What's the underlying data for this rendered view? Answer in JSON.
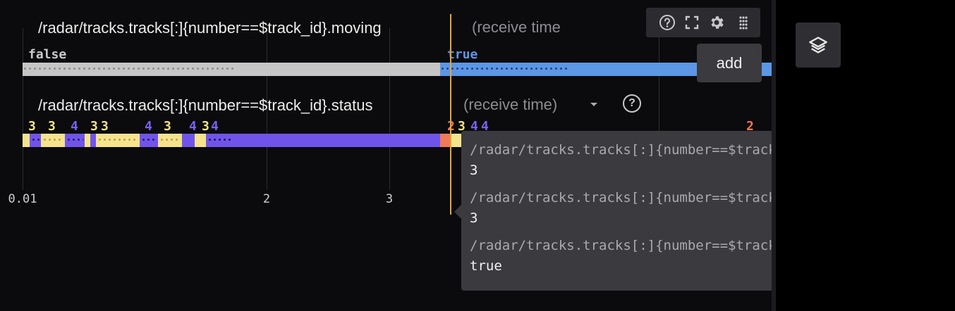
{
  "plot": {
    "row1": {
      "topic": "/radar/tracks.tracks[:]{number==$track_id}.moving",
      "time_selector": "(receive time)",
      "labels": [
        "false",
        "true"
      ],
      "segment_values": [
        "false",
        "true"
      ]
    },
    "row2": {
      "topic": "/radar/tracks.tracks[:]{number==$track_id}.status",
      "time_selector": "(receive time)",
      "labels": [
        "3",
        "3",
        "4",
        "3",
        "3",
        "4",
        "3",
        "4",
        "3",
        "4",
        "2",
        "3",
        "4",
        "4",
        "2"
      ]
    },
    "x_axis": {
      "ticks": [
        "0.01",
        "2",
        "3"
      ]
    }
  },
  "toolbar": {
    "icons": [
      "help-icon",
      "fullscreen-icon",
      "gear-icon",
      "drag-grid-icon"
    ],
    "add_tooltip": "add"
  },
  "hover_tooltip": {
    "entries": [
      {
        "path": "/radar/tracks.tracks[:]{number==$track_id}.status",
        "value": "3"
      },
      {
        "path": "/radar/tracks.tracks[:]{number==$track_id}.status",
        "value": "3"
      },
      {
        "path": "/radar/tracks.tracks[:]{number==$track_id}.moving",
        "value": "true"
      }
    ]
  },
  "right_panel": {
    "button_icon": "layers-icon"
  },
  "colors": {
    "state_false": "#c6c6c6",
    "state_true": "#5b97e5",
    "status_3": "#f5e38e",
    "status_4": "#7054ea",
    "status_2": "#ef7a58",
    "cursor": "#e3a72f"
  }
}
